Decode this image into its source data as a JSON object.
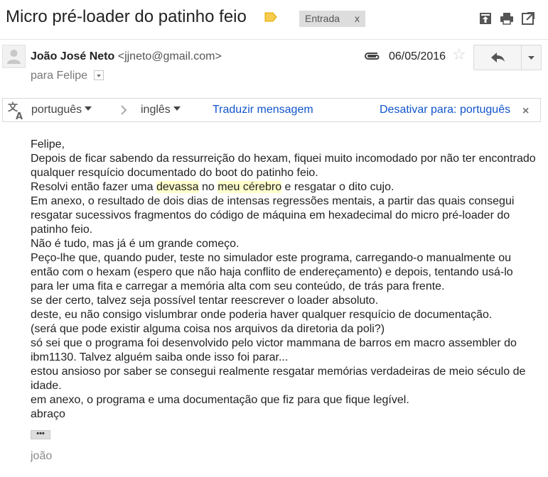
{
  "header": {
    "subject": "Micro pré-loader do patinho feio",
    "label_chip": "Entrada",
    "label_chip_close": "x",
    "label_color": "#f7cb4d",
    "icons": [
      "archive-icon",
      "print-icon",
      "new-window-icon"
    ]
  },
  "message": {
    "sender_name": "João José Neto",
    "sender_email": "<jjneto@gmail.com>",
    "to_line": "para Felipe",
    "date": "06/05/2016",
    "star": "☆"
  },
  "translate": {
    "source_lang": "português",
    "target_lang": "inglês",
    "translate_link": "Traduzir mensagem",
    "disable_link": "Desativar para: português",
    "close": "×"
  },
  "body": {
    "line1": "Felipe,",
    "line2": "Depois de ficar sabendo da ressurreição do hexam, fiquei muito incomodado por não ter encontrado qualquer resquício documentado do boot do patinho feio.",
    "line3_a": "Resolvi então fazer uma ",
    "line3_h1": "devassa",
    "line3_b": " no ",
    "line3_h2": "meu cérebro",
    "line3_c": " e resgatar o dito cujo.",
    "line4": "Em anexo, o resultado de dois dias de intensas regressões mentais, a partir das quais consegui resgatar sucessivos fragmentos do código de máquina em hexadecimal do micro pré-loader do patinho feio.",
    "line5": "Não é tudo, mas já é um grande começo.",
    "line6": "Peço-lhe que, quando puder, teste no simulador este programa, carregando-o manualmente ou então com o hexam (espero que não haja conflito de endereçamento) e depois, tentando usá-lo para ler uma fita e carregar a memória alta com seu conteúdo, de trás para frente.",
    "line7": "se der certo, talvez seja possível tentar reescrever o loader absoluto.",
    "line8": "deste, eu não consigo vislumbrar onde poderia haver qualquer resquício de documentação.",
    "line9": "(será que pode existir alguma coisa nos arquivos da diretoria da poli?)",
    "line10": "só sei que o programa foi desenvolvido pelo victor mammana de barros em macro assembler do ibm1130. Talvez alguém saiba onde isso foi parar...",
    "line11": "estou ansioso por saber se consegui realmente resgatar memórias verdadeiras de meio século de idade.",
    "line12": "em anexo, o programa e uma documentação que fiz para que fique legível.",
    "line13": "abraço",
    "ellipsis": "•••",
    "signature": "joão"
  }
}
